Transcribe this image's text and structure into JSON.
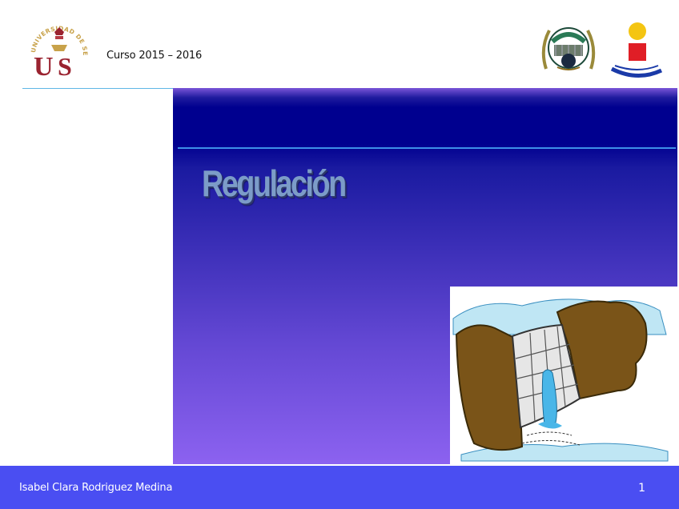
{
  "header": {
    "course_label": "Curso 2015 – 2016",
    "logo_left_text": "UNIVERSIDAD DE SEVILLA"
  },
  "slide": {
    "title": "Regulación",
    "title_color": "#7c9cc8",
    "panel_top_color": "#00008f",
    "panel_bottom_color": "#8c62f0",
    "illustration": "dam-illustration"
  },
  "footer": {
    "author": "Isabel Clara Rodriguez Medina",
    "page_number": "1",
    "background_color": "#4a4ef2"
  }
}
